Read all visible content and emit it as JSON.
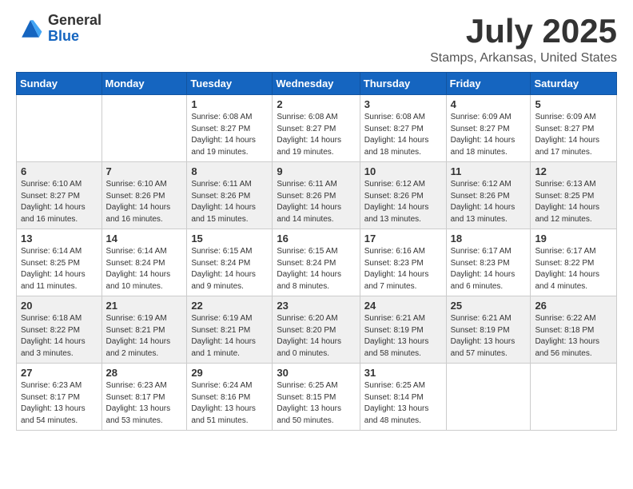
{
  "logo": {
    "general": "General",
    "blue": "Blue"
  },
  "title": "July 2025",
  "subtitle": "Stamps, Arkansas, United States",
  "days_of_week": [
    "Sunday",
    "Monday",
    "Tuesday",
    "Wednesday",
    "Thursday",
    "Friday",
    "Saturday"
  ],
  "weeks": [
    [
      {
        "day": "",
        "empty": true
      },
      {
        "day": "",
        "empty": true
      },
      {
        "day": "1",
        "sunrise": "Sunrise: 6:08 AM",
        "sunset": "Sunset: 8:27 PM",
        "daylight": "Daylight: 14 hours and 19 minutes."
      },
      {
        "day": "2",
        "sunrise": "Sunrise: 6:08 AM",
        "sunset": "Sunset: 8:27 PM",
        "daylight": "Daylight: 14 hours and 19 minutes."
      },
      {
        "day": "3",
        "sunrise": "Sunrise: 6:08 AM",
        "sunset": "Sunset: 8:27 PM",
        "daylight": "Daylight: 14 hours and 18 minutes."
      },
      {
        "day": "4",
        "sunrise": "Sunrise: 6:09 AM",
        "sunset": "Sunset: 8:27 PM",
        "daylight": "Daylight: 14 hours and 18 minutes."
      },
      {
        "day": "5",
        "sunrise": "Sunrise: 6:09 AM",
        "sunset": "Sunset: 8:27 PM",
        "daylight": "Daylight: 14 hours and 17 minutes."
      }
    ],
    [
      {
        "day": "6",
        "sunrise": "Sunrise: 6:10 AM",
        "sunset": "Sunset: 8:27 PM",
        "daylight": "Daylight: 14 hours and 16 minutes."
      },
      {
        "day": "7",
        "sunrise": "Sunrise: 6:10 AM",
        "sunset": "Sunset: 8:26 PM",
        "daylight": "Daylight: 14 hours and 16 minutes."
      },
      {
        "day": "8",
        "sunrise": "Sunrise: 6:11 AM",
        "sunset": "Sunset: 8:26 PM",
        "daylight": "Daylight: 14 hours and 15 minutes."
      },
      {
        "day": "9",
        "sunrise": "Sunrise: 6:11 AM",
        "sunset": "Sunset: 8:26 PM",
        "daylight": "Daylight: 14 hours and 14 minutes."
      },
      {
        "day": "10",
        "sunrise": "Sunrise: 6:12 AM",
        "sunset": "Sunset: 8:26 PM",
        "daylight": "Daylight: 14 hours and 13 minutes."
      },
      {
        "day": "11",
        "sunrise": "Sunrise: 6:12 AM",
        "sunset": "Sunset: 8:26 PM",
        "daylight": "Daylight: 14 hours and 13 minutes."
      },
      {
        "day": "12",
        "sunrise": "Sunrise: 6:13 AM",
        "sunset": "Sunset: 8:25 PM",
        "daylight": "Daylight: 14 hours and 12 minutes."
      }
    ],
    [
      {
        "day": "13",
        "sunrise": "Sunrise: 6:14 AM",
        "sunset": "Sunset: 8:25 PM",
        "daylight": "Daylight: 14 hours and 11 minutes."
      },
      {
        "day": "14",
        "sunrise": "Sunrise: 6:14 AM",
        "sunset": "Sunset: 8:24 PM",
        "daylight": "Daylight: 14 hours and 10 minutes."
      },
      {
        "day": "15",
        "sunrise": "Sunrise: 6:15 AM",
        "sunset": "Sunset: 8:24 PM",
        "daylight": "Daylight: 14 hours and 9 minutes."
      },
      {
        "day": "16",
        "sunrise": "Sunrise: 6:15 AM",
        "sunset": "Sunset: 8:24 PM",
        "daylight": "Daylight: 14 hours and 8 minutes."
      },
      {
        "day": "17",
        "sunrise": "Sunrise: 6:16 AM",
        "sunset": "Sunset: 8:23 PM",
        "daylight": "Daylight: 14 hours and 7 minutes."
      },
      {
        "day": "18",
        "sunrise": "Sunrise: 6:17 AM",
        "sunset": "Sunset: 8:23 PM",
        "daylight": "Daylight: 14 hours and 6 minutes."
      },
      {
        "day": "19",
        "sunrise": "Sunrise: 6:17 AM",
        "sunset": "Sunset: 8:22 PM",
        "daylight": "Daylight: 14 hours and 4 minutes."
      }
    ],
    [
      {
        "day": "20",
        "sunrise": "Sunrise: 6:18 AM",
        "sunset": "Sunset: 8:22 PM",
        "daylight": "Daylight: 14 hours and 3 minutes."
      },
      {
        "day": "21",
        "sunrise": "Sunrise: 6:19 AM",
        "sunset": "Sunset: 8:21 PM",
        "daylight": "Daylight: 14 hours and 2 minutes."
      },
      {
        "day": "22",
        "sunrise": "Sunrise: 6:19 AM",
        "sunset": "Sunset: 8:21 PM",
        "daylight": "Daylight: 14 hours and 1 minute."
      },
      {
        "day": "23",
        "sunrise": "Sunrise: 6:20 AM",
        "sunset": "Sunset: 8:20 PM",
        "daylight": "Daylight: 14 hours and 0 minutes."
      },
      {
        "day": "24",
        "sunrise": "Sunrise: 6:21 AM",
        "sunset": "Sunset: 8:19 PM",
        "daylight": "Daylight: 13 hours and 58 minutes."
      },
      {
        "day": "25",
        "sunrise": "Sunrise: 6:21 AM",
        "sunset": "Sunset: 8:19 PM",
        "daylight": "Daylight: 13 hours and 57 minutes."
      },
      {
        "day": "26",
        "sunrise": "Sunrise: 6:22 AM",
        "sunset": "Sunset: 8:18 PM",
        "daylight": "Daylight: 13 hours and 56 minutes."
      }
    ],
    [
      {
        "day": "27",
        "sunrise": "Sunrise: 6:23 AM",
        "sunset": "Sunset: 8:17 PM",
        "daylight": "Daylight: 13 hours and 54 minutes."
      },
      {
        "day": "28",
        "sunrise": "Sunrise: 6:23 AM",
        "sunset": "Sunset: 8:17 PM",
        "daylight": "Daylight: 13 hours and 53 minutes."
      },
      {
        "day": "29",
        "sunrise": "Sunrise: 6:24 AM",
        "sunset": "Sunset: 8:16 PM",
        "daylight": "Daylight: 13 hours and 51 minutes."
      },
      {
        "day": "30",
        "sunrise": "Sunrise: 6:25 AM",
        "sunset": "Sunset: 8:15 PM",
        "daylight": "Daylight: 13 hours and 50 minutes."
      },
      {
        "day": "31",
        "sunrise": "Sunrise: 6:25 AM",
        "sunset": "Sunset: 8:14 PM",
        "daylight": "Daylight: 13 hours and 48 minutes."
      },
      {
        "day": "",
        "empty": true
      },
      {
        "day": "",
        "empty": true
      }
    ]
  ]
}
